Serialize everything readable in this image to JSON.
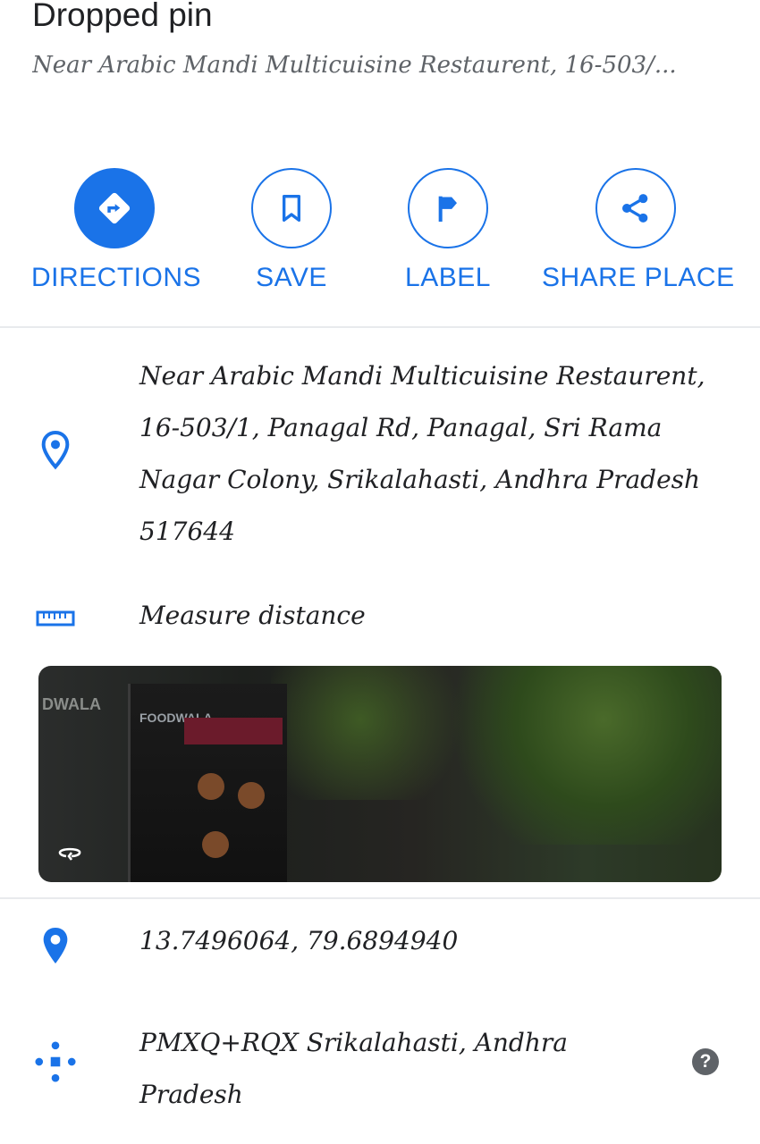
{
  "place": {
    "title": "Dropped pin",
    "subtitle": "Near Arabic Mandi Multicuisine Restaurent, 16-503/..."
  },
  "actions": [
    {
      "label": "DIRECTIONS",
      "icon": "directions-icon"
    },
    {
      "label": "SAVE",
      "icon": "bookmark-icon"
    },
    {
      "label": "LABEL",
      "icon": "flag-icon"
    },
    {
      "label": "SHARE PLACE",
      "icon": "share-icon"
    }
  ],
  "details": {
    "address": "Near Arabic Mandi Multicuisine Restaurent, 16-503/1, Panagal Rd, Panagal, Sri Rama Nagar Colony, Srikalahasti, Andhra Pradesh 517644",
    "measure_label": "Measure distance",
    "coordinates": "13.7496064, 79.6894940",
    "plus_code": "PMXQ+RQX Srikalahasti, Andhra Pradesh"
  },
  "photo": {
    "brand_text": "DWALA",
    "sign_text": "FOODWALA"
  },
  "colors": {
    "accent": "#1a73e8",
    "text": "#202124",
    "secondary": "#5f6368",
    "divider": "#e8eaed"
  }
}
